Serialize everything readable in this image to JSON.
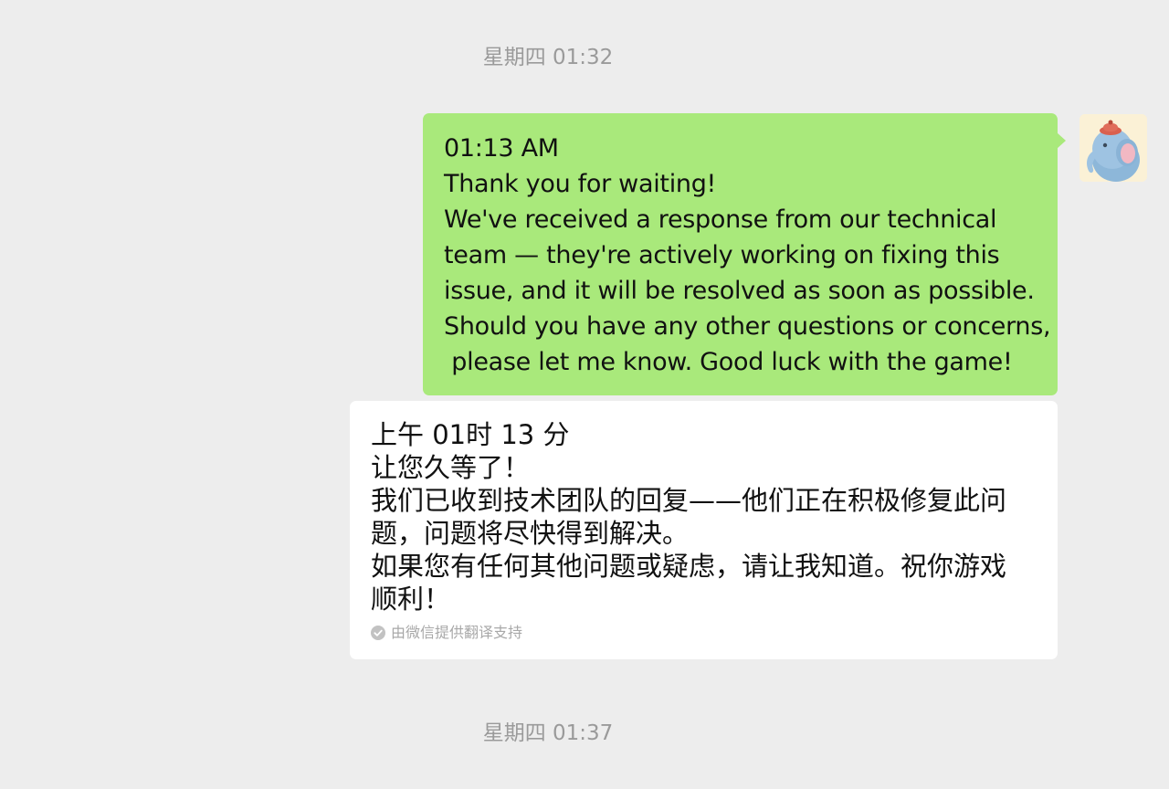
{
  "timestamps": {
    "top": "星期四 01:32",
    "bottom": "星期四 01:37"
  },
  "message_sent": {
    "lines": [
      "01:13 AM",
      "Thank you for waiting!",
      "We've received a response from our technical",
      "team — they're actively working on fixing this",
      "issue, and it will be resolved as soon as possible.",
      "Should you have any other questions or concerns,",
      " please let me know. Good luck with the game!"
    ]
  },
  "translation": {
    "lines": [
      "上午 01时 13 分",
      "让您久等了！",
      "我们已收到技术团队的回复——他们正在积极修复此问",
      "题，问题将尽快得到解决。",
      "如果您有任何其他问题或疑虑，请让我知道。祝你游戏",
      "顺利！"
    ],
    "note": "由微信提供翻译支持"
  },
  "avatar": {
    "icon": "elephant-avatar-icon"
  },
  "colors": {
    "background": "#ededed",
    "sent_bubble": "#a9e97b",
    "translation_bubble": "#ffffff",
    "timestamp_text": "#9a9a9a",
    "note_text": "#a8a8a8"
  }
}
